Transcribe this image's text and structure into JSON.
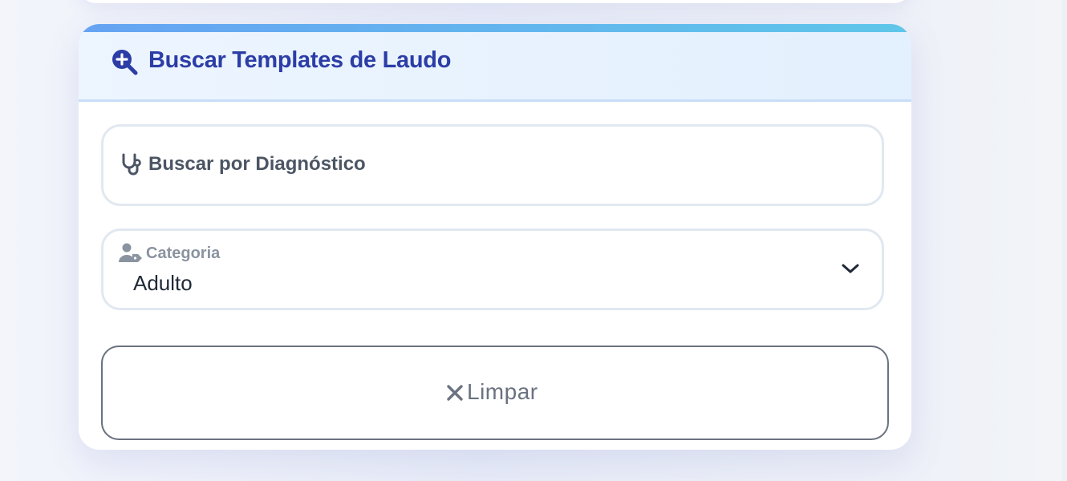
{
  "search_card": {
    "title": "Buscar Templates de Laudo",
    "title_icon": "search-plus-icon",
    "accent_gradient": [
      "#66a3f3",
      "#5fc6e9"
    ],
    "title_color": "#2c3da6"
  },
  "diagnosis_field": {
    "label": "Buscar por Diagnóstico",
    "icon": "stethoscope-icon",
    "value": ""
  },
  "category_field": {
    "label": "Categoria",
    "icon": "user-tag-icon",
    "selected": "Adulto",
    "dropdown_icon": "chevron-down-icon"
  },
  "clear_button": {
    "label": "Limpar",
    "icon": "close-icon"
  }
}
